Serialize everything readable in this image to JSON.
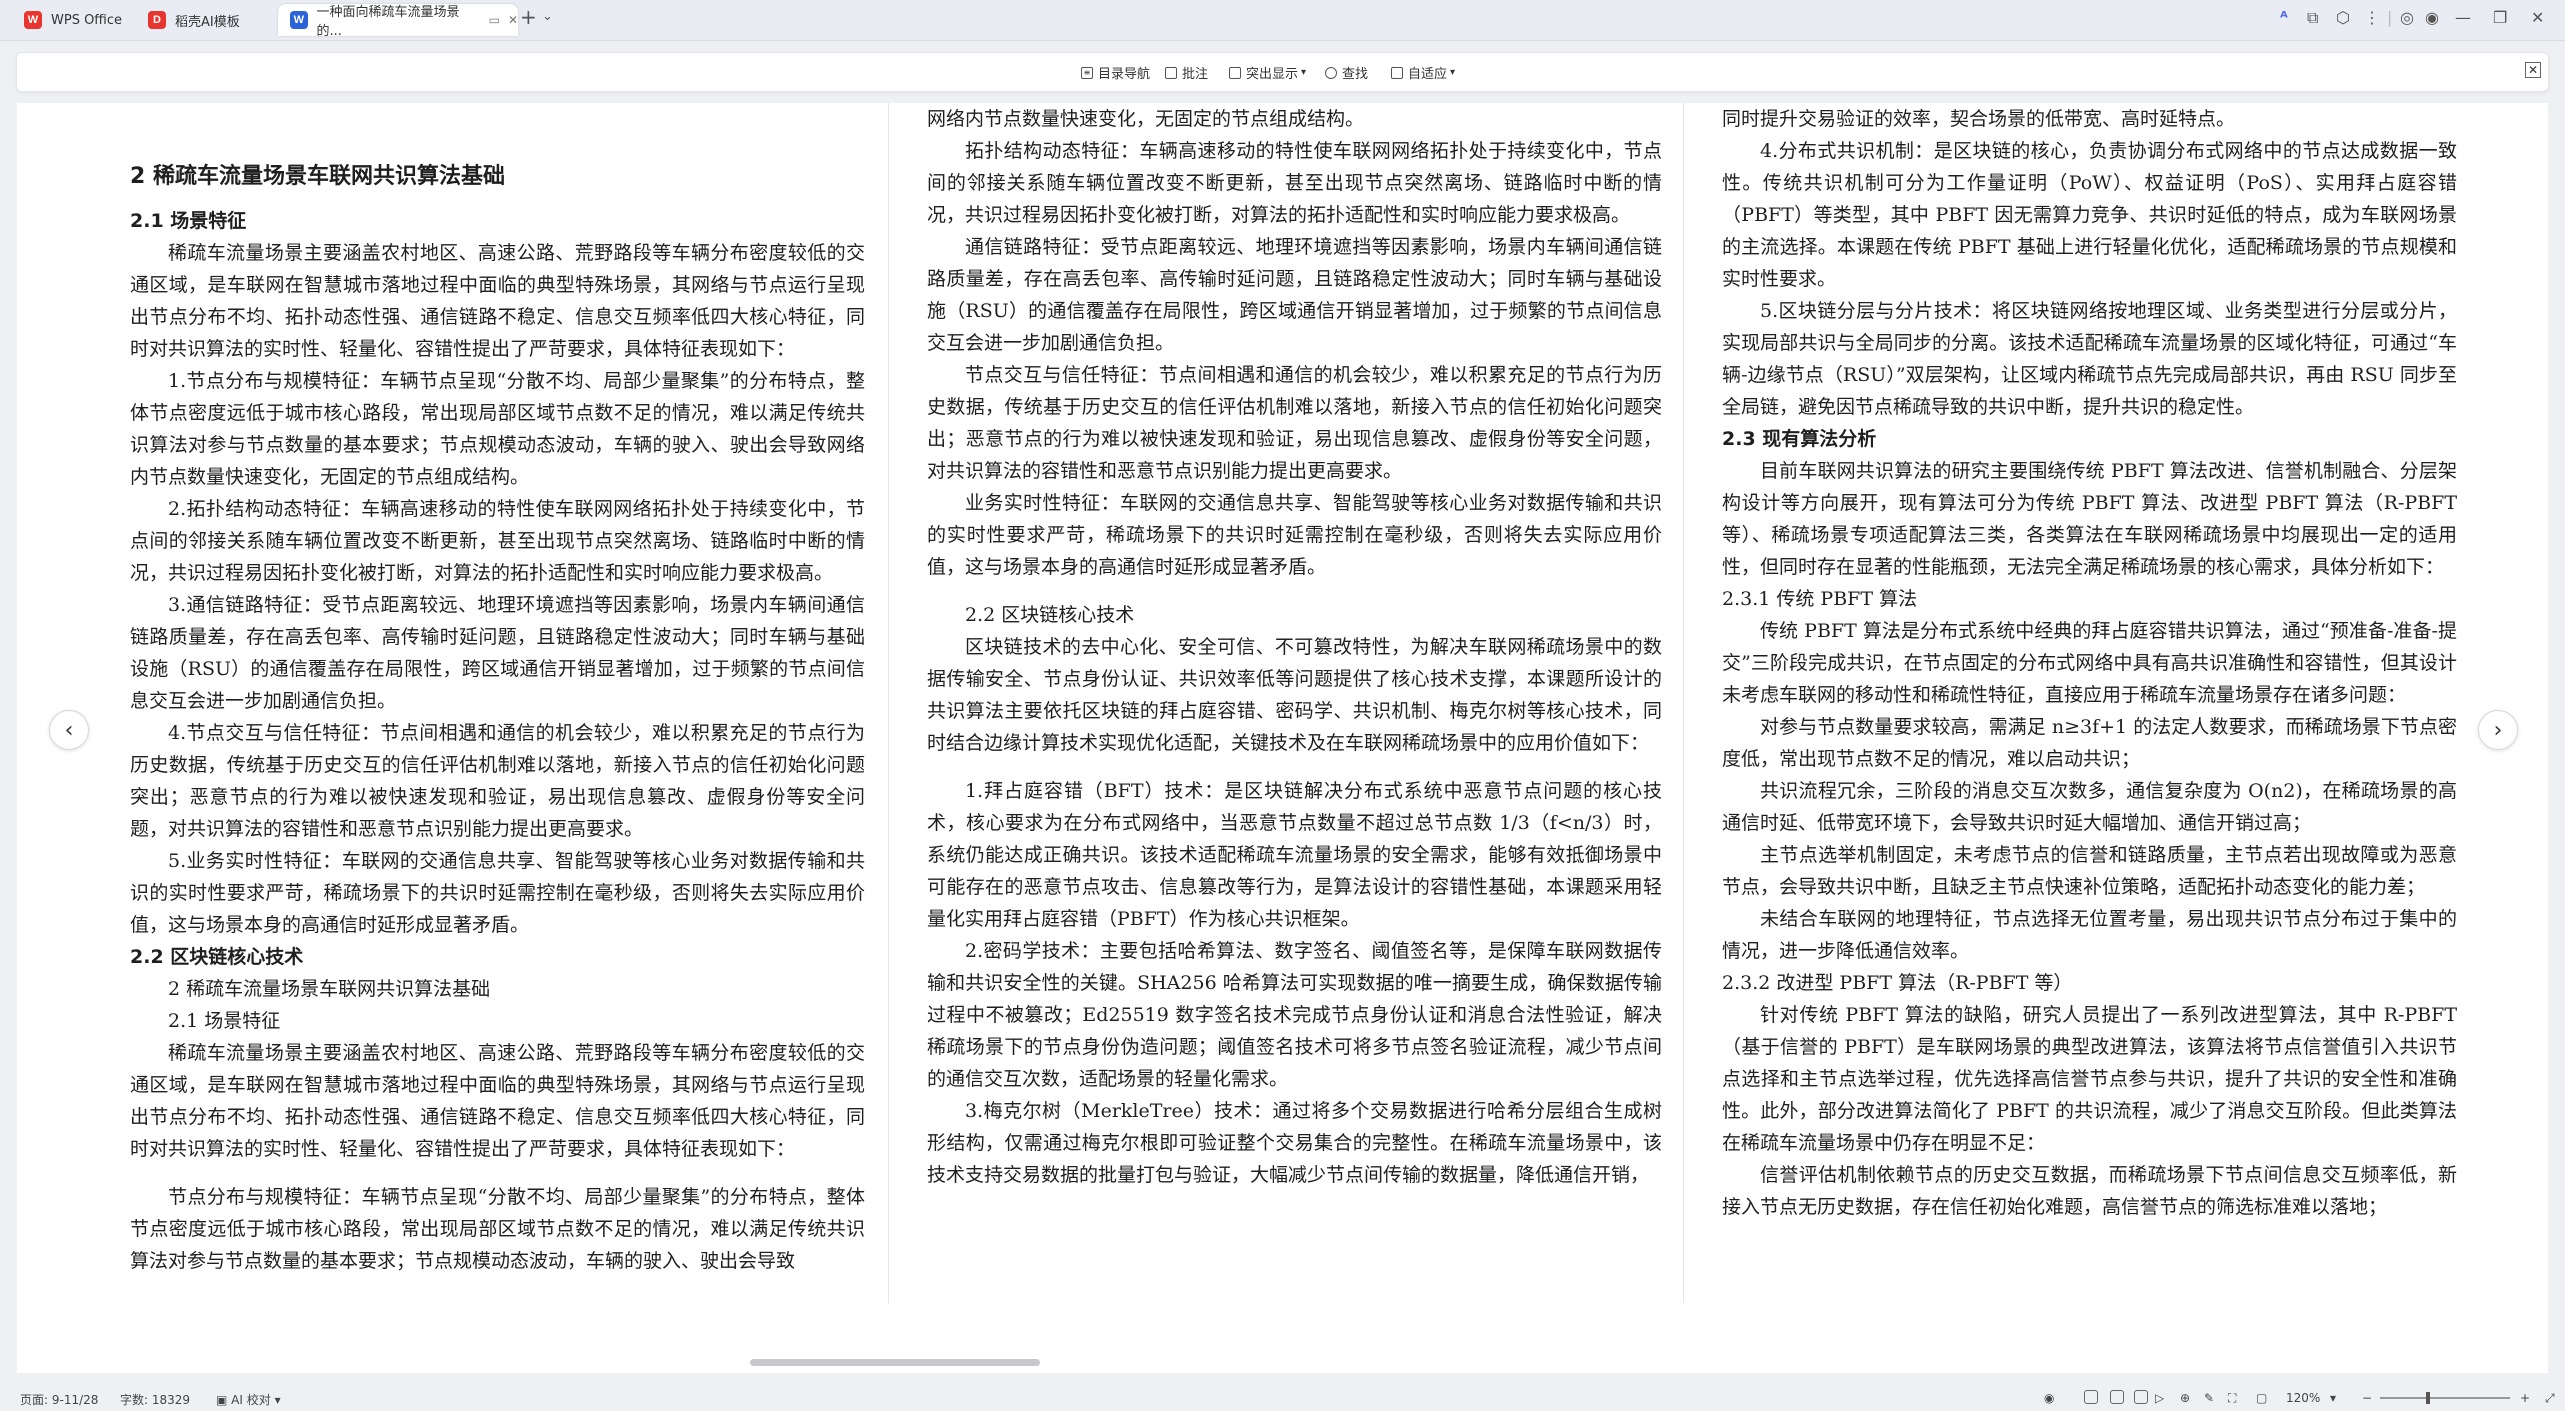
{
  "titlebar": {
    "tabs": [
      {
        "label": "WPS Office",
        "logo": "W",
        "logo_color": "#e8352f"
      },
      {
        "label": "稻壳AI模板",
        "logo": "D",
        "logo_color": "#e8352f"
      },
      {
        "label": "一种面向稀疏车流量场景的...",
        "logo": "W",
        "logo_color": "#2b62d8",
        "active": true
      }
    ],
    "new_tab": "+",
    "menu_caret": "⌄"
  },
  "toolbar": {
    "items": [
      "目录导航",
      "批注",
      "突出显示",
      "查找",
      "自适应"
    ],
    "close": "✕"
  },
  "document": {
    "col1": {
      "chapter": "2 稀疏车流量场景车联网共识算法基础",
      "s21": "2.1 场景特征",
      "p_intro": "稀疏车流量场景主要涵盖农村地区、高速公路、荒野路段等车辆分布密度较低的交通区域，是车联网在智慧城市落地过程中面临的典型特殊场景，其网络与节点运行呈现出节点分布不均、拓扑动态性强、通信链路不稳定、信息交互频率低四大核心特征，同时对共识算法的实时性、轻量化、容错性提出了严苛要求，具体特征表现如下：",
      "p1": "1.节点分布与规模特征：车辆节点呈现“分散不均、局部少量聚集”的分布特点，整体节点密度远低于城市核心路段，常出现局部区域节点数不足的情况，难以满足传统共识算法对参与节点数量的基本要求；节点规模动态波动，车辆的驶入、驶出会导致网络内节点数量快速变化，无固定的节点组成结构。",
      "p2": "2.拓扑结构动态特征：车辆高速移动的特性使车联网网络拓扑处于持续变化中，节点间的邻接关系随车辆位置改变不断更新，甚至出现节点突然离场、链路临时中断的情况，共识过程易因拓扑变化被打断，对算法的拓扑适配性和实时响应能力要求极高。",
      "p3": "3.通信链路特征：受节点距离较远、地理环境遮挡等因素影响，场景内车辆间通信链路质量差，存在高丢包率、高传输时延问题，且链路稳定性波动大；同时车辆与基础设施（RSU）的通信覆盖存在局限性，跨区域通信开销显著增加，过于频繁的节点间信息交互会进一步加剧通信负担。",
      "p4": "4.节点交互与信任特征：节点间相遇和通信的机会较少，难以积累充足的节点行为历史数据，传统基于历史交互的信任评估机制难以落地，新接入节点的信任初始化问题突出；恶意节点的行为难以被快速发现和验证，易出现信息篡改、虚假身份等安全问题，对共识算法的容错性和恶意节点识别能力提出更高要求。",
      "p5": "5.业务实时性特征：车联网的交通信息共享、智能驾驶等核心业务对数据传输和共识的实时性要求严苛，稀疏场景下的共识时延需控制在毫秒级，否则将失去实际应用价值，这与场景本身的高通信时延形成显著矛盾。",
      "s22": "2.2 区块链核心技术",
      "rep_chapter": "2 稀疏车流量场景车联网共识算法基础",
      "rep_s21": "2.1 场景特征",
      "rep_intro": "稀疏车流量场景主要涵盖农村地区、高速公路、荒野路段等车辆分布密度较低的交通区域，是车联网在智慧城市落地过程中面临的典型特殊场景，其网络与节点运行呈现出节点分布不均、拓扑动态性强、通信链路不稳定、信息交互频率低四大核心特征，同时对共识算法的实时性、轻量化、容错性提出了严苛要求，具体特征表现如下：",
      "rep_p1": "节点分布与规模特征：车辆节点呈现“分散不均、局部少量聚集”的分布特点，整体节点密度远低于城市核心路段，常出现局部区域节点数不足的情况，难以满足传统共识算法对参与节点数量的基本要求；节点规模动态波动，车辆的驶入、驶出会导致"
    },
    "col2": {
      "c1": "网络内节点数量快速变化，无固定的节点组成结构。",
      "c2": "拓扑结构动态特征：车辆高速移动的特性使车联网网络拓扑处于持续变化中，节点间的邻接关系随车辆位置改变不断更新，甚至出现节点突然离场、链路临时中断的情况，共识过程易因拓扑变化被打断，对算法的拓扑适配性和实时响应能力要求极高。",
      "c3": "通信链路特征：受节点距离较远、地理环境遮挡等因素影响，场景内车辆间通信链路质量差，存在高丢包率、高传输时延问题，且链路稳定性波动大；同时车辆与基础设施（RSU）的通信覆盖存在局限性，跨区域通信开销显著增加，过于频繁的节点间信息交互会进一步加剧通信负担。",
      "c4": "节点交互与信任特征：节点间相遇和通信的机会较少，难以积累充足的节点行为历史数据，传统基于历史交互的信任评估机制难以落地，新接入节点的信任初始化问题突出；恶意节点的行为难以被快速发现和验证，易出现信息篡改、虚假身份等安全问题，对共识算法的容错性和恶意节点识别能力提出更高要求。",
      "c5": "业务实时性特征：车联网的交通信息共享、智能驾驶等核心业务对数据传输和共识的实时性要求严苛，稀疏场景下的共识时延需控制在毫秒级，否则将失去实际应用价值，这与场景本身的高通信时延形成显著矛盾。",
      "s22": "2.2 区块链核心技术",
      "c6": "区块链技术的去中心化、安全可信、不可篡改特性，为解决车联网稀疏场景中的数据传输安全、节点身份认证、共识效率低等问题提供了核心技术支撑，本课题所设计的共识算法主要依托区块链的拜占庭容错、密码学、共识机制、梅克尔树等核心技术，同时结合边缘计算技术实现优化适配，关键技术及在车联网稀疏场景中的应用价值如下：",
      "c7": "1.拜占庭容错（BFT）技术：是区块链解决分布式系统中恶意节点问题的核心技术，核心要求为在分布式网络中，当恶意节点数量不超过总节点数 1/3（f<n/3）时，系统仍能达成正确共识。该技术适配稀疏车流量场景的安全需求，能够有效抵御场景中可能存在的恶意节点攻击、信息篡改等行为，是算法设计的容错性基础，本课题采用轻量化实用拜占庭容错（PBFT）作为核心共识框架。",
      "c8": "2.密码学技术：主要包括哈希算法、数字签名、阈值签名等，是保障车联网数据传输和共识安全性的关键。SHA256 哈希算法可实现数据的唯一摘要生成，确保数据传输过程中不被篡改；Ed25519 数字签名技术完成节点身份认证和消息合法性验证，解决稀疏场景下的节点身份伪造问题；阈值签名技术可将多节点签名验证流程，减少节点间的通信交互次数，适配场景的轻量化需求。",
      "c9": "3.梅克尔树（MerkleTree）技术：通过将多个交易数据进行哈希分层组合生成树形结构，仅需通过梅克尔根即可验证整个交易集合的完整性。在稀疏车流量场景中，该技术支持交易数据的批量打包与验证，大幅减少节点间传输的数据量，降低通信开销，"
    },
    "col3": {
      "c1": "同时提升交易验证的效率，契合场景的低带宽、高时延特点。",
      "c2": "4.分布式共识机制：是区块链的核心，负责协调分布式网络中的节点达成数据一致性。传统共识机制可分为工作量证明（PoW）、权益证明（PoS）、实用拜占庭容错（PBFT）等类型，其中 PBFT 因无需算力竞争、共识时延低的特点，成为车联网场景的主流选择。本课题在传统 PBFT 基础上进行轻量化优化，适配稀疏场景的节点规模和实时性要求。",
      "c3": "5.区块链分层与分片技术：将区块链网络按地理区域、业务类型进行分层或分片，实现局部共识与全局同步的分离。该技术适配稀疏车流量场景的区域化特征，可通过“车辆-边缘节点（RSU）”双层架构，让区域内稀疏节点先完成局部共识，再由 RSU 同步至全局链，避免因节点稀疏导致的共识中断，提升共识的稳定性。",
      "s23": "2.3 现有算法分析",
      "c4": "目前车联网共识算法的研究主要围绕传统 PBFT 算法改进、信誉机制融合、分层架构设计等方向展开，现有算法可分为传统 PBFT 算法、改进型 PBFT 算法（R-PBFT 等）、稀疏场景专项适配算法三类，各类算法在车联网稀疏场景中均展现出一定的适用性，但同时存在显著的性能瓶颈，无法完全满足稀疏场景的核心需求，具体分析如下：",
      "s231": "2.3.1 传统 PBFT 算法",
      "c5": "传统 PBFT 算法是分布式系统中经典的拜占庭容错共识算法，通过“预准备-准备-提交”三阶段完成共识，在节点固定的分布式网络中具有高共识准确性和容错性，但其设计未考虑车联网的移动性和稀疏性特征，直接应用于稀疏车流量场景存在诸多问题：",
      "c6": "对参与节点数量要求较高，需满足 n≥3f+1 的法定人数要求，而稀疏场景下节点密度低，常出现节点数不足的情况，难以启动共识；",
      "c7": "共识流程冗余，三阶段的消息交互次数多，通信复杂度为 O(n2)，在稀疏场景的高通信时延、低带宽环境下，会导致共识时延大幅增加、通信开销过高；",
      "c8": "主节点选举机制固定，未考虑节点的信誉和链路质量，主节点若出现故障或为恶意节点，会导致共识中断，且缺乏主节点快速补位策略，适配拓扑动态变化的能力差；",
      "c9": "未结合车联网的地理特征，节点选择无位置考量，易出现共识节点分布过于集中的情况，进一步降低通信效率。",
      "s232": "2.3.2 改进型 PBFT 算法（R-PBFT 等）",
      "c10": "针对传统 PBFT 算法的缺陷，研究人员提出了一系列改进型算法，其中 R-PBFT（基于信誉的 PBFT）是车联网场景的典型改进算法，该算法将节点信誉值引入共识节点选择和主节点选举过程，优先选择高信誉节点参与共识，提升了共识的安全性和准确性。此外，部分改进算法简化了 PBFT 的共识流程，减少了消息交互阶段。但此类算法在稀疏车流量场景中仍存在明显不足：",
      "c11": "信誉评估机制依赖节点的历史交互数据，而稀疏场景下节点间信息交互频率低，新接入节点无历史数据，存在信任初始化难题，高信誉节点的筛选标准难以落地；"
    }
  },
  "statusbar": {
    "pages": "页面: 9-11/28",
    "words": "字数: 18329",
    "ai_check": "AI 校对",
    "zoom": "120%"
  }
}
